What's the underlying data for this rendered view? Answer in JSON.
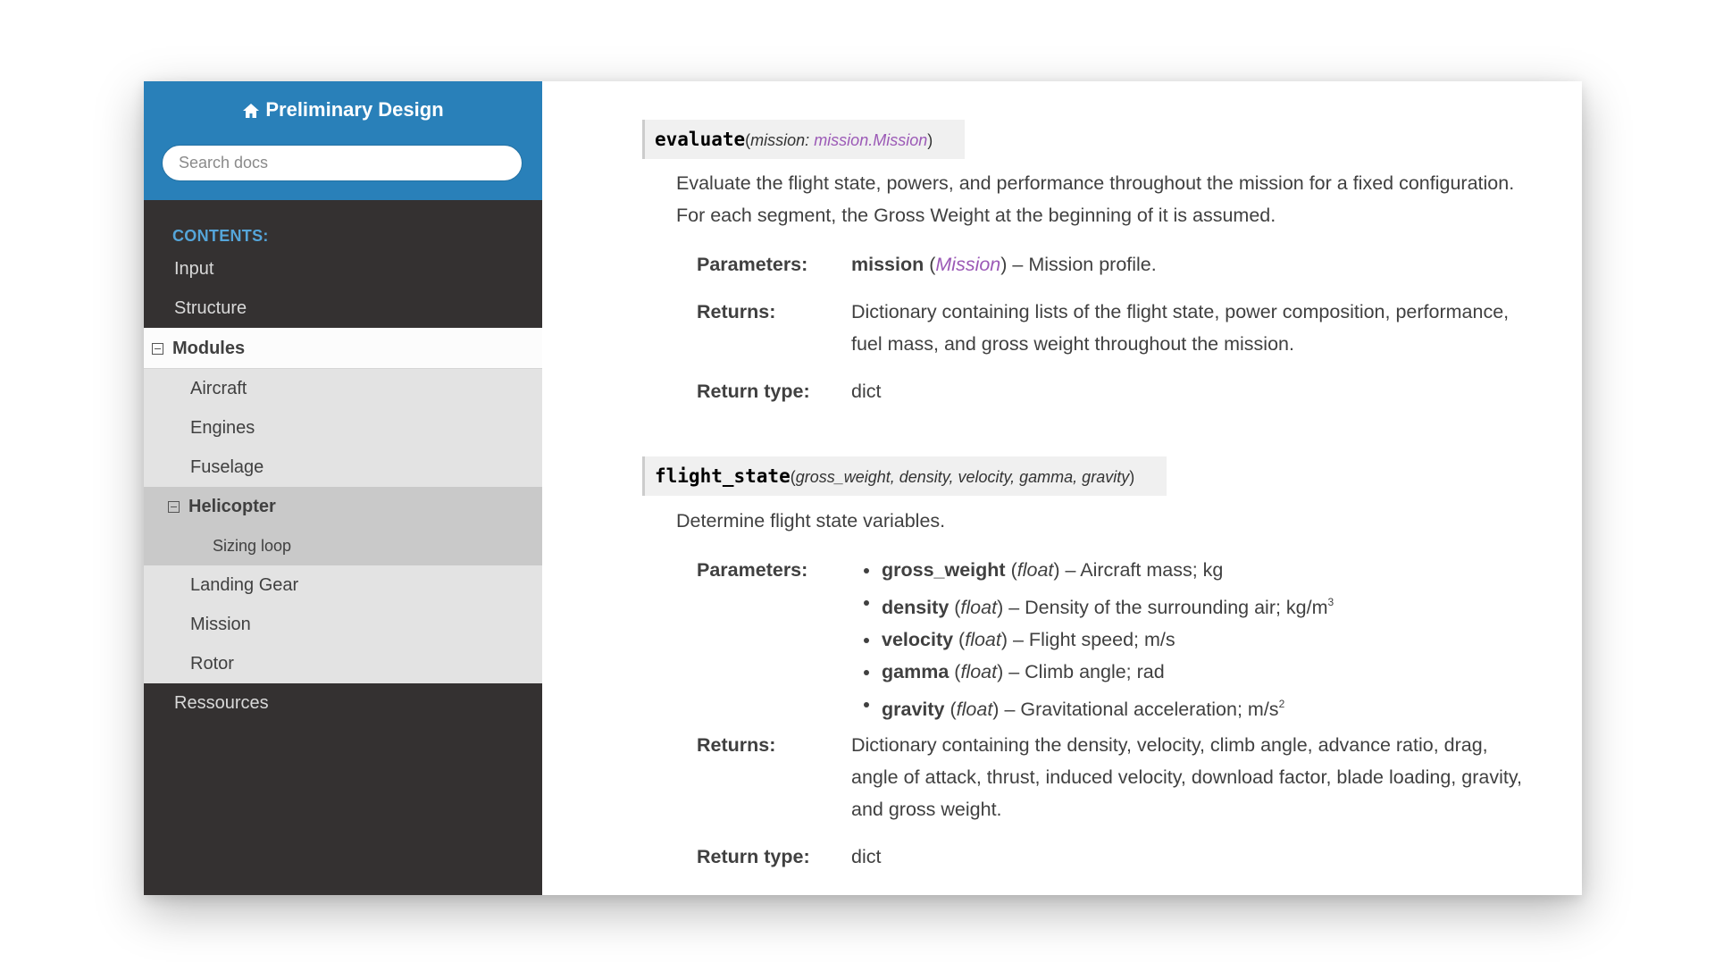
{
  "sidebar": {
    "brand": "Preliminary Design",
    "search_placeholder": "Search docs",
    "caption": "CONTENTS:",
    "items": [
      {
        "label": "Input"
      },
      {
        "label": "Structure"
      },
      {
        "label": "Modules"
      },
      {
        "label": "Aircraft"
      },
      {
        "label": "Engines"
      },
      {
        "label": "Fuselage"
      },
      {
        "label": "Helicopter"
      },
      {
        "label": "Sizing loop"
      },
      {
        "label": "Landing Gear"
      },
      {
        "label": "Mission"
      },
      {
        "label": "Rotor"
      },
      {
        "label": "Ressources"
      }
    ]
  },
  "evaluate": {
    "name": "evaluate",
    "open_paren": "(",
    "param": "mission:",
    "param_type": "mission.Mission",
    "close_paren": ")",
    "description": "Evaluate the flight state, powers, and performance throughout the mission for a fixed configuration. For each segment, the Gross Weight at the beginning of it is assumed.",
    "parameters_label": "Parameters:",
    "param_name": "mission",
    "param_type_short": "Mission",
    "param_desc": "– Mission profile.",
    "returns_label": "Returns:",
    "returns": "Dictionary containing lists of the flight state, power composition, performance, fuel mass, and gross weight throughout the mission.",
    "return_type_label": "Return type:",
    "return_type": "dict"
  },
  "flight_state": {
    "name": "flight_state",
    "open_paren": "(",
    "args": "gross_weight, density, velocity, gamma, gravity",
    "close_paren": ")",
    "description": "Determine flight state variables.",
    "parameters_label": "Parameters:",
    "params": [
      {
        "name": "gross_weight",
        "type": "float",
        "desc": "– Aircraft mass; kg",
        "sup": ""
      },
      {
        "name": "density",
        "type": "float",
        "desc": "– Density of the surrounding air; kg/m",
        "sup": "3"
      },
      {
        "name": "velocity",
        "type": "float",
        "desc": "– Flight speed; m/s",
        "sup": ""
      },
      {
        "name": "gamma",
        "type": "float",
        "desc": "– Climb angle; rad",
        "sup": ""
      },
      {
        "name": "gravity",
        "type": "float",
        "desc": "– Gravitational acceleration; m/s",
        "sup": "2"
      }
    ],
    "returns_label": "Returns:",
    "returns": "Dictionary containing the density, velocity, climb angle, advance ratio, drag, angle of attack, thrust, induced velocity, download factor, blade loading, gravity, and gross weight.",
    "return_type_label": "Return type:",
    "return_type": "dict"
  },
  "colors": {
    "brand_blue": "#2980B9",
    "sidebar_dark": "#343131",
    "caption_blue": "#55a5d9",
    "type_purple": "#9b59b6"
  }
}
